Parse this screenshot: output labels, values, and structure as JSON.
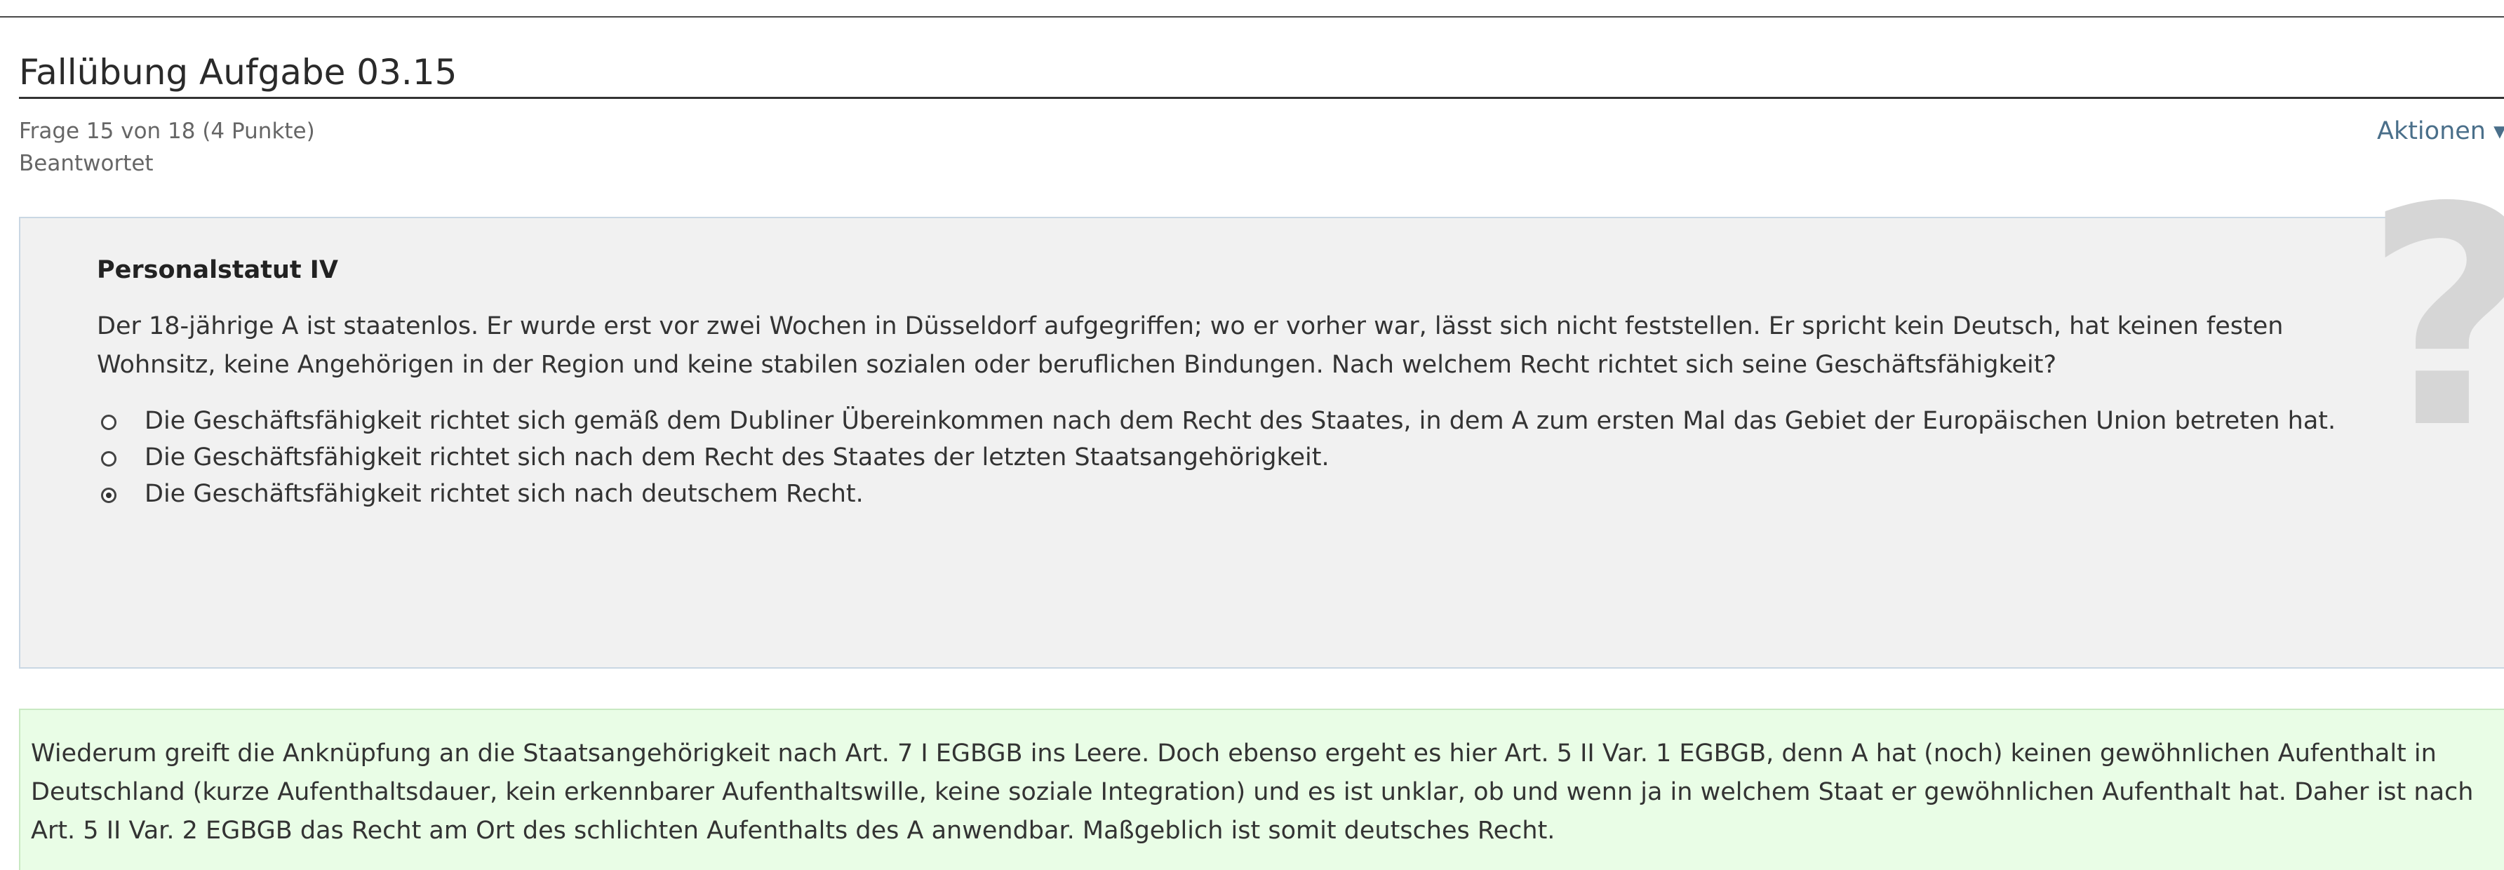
{
  "page": {
    "title": "Fallübung Aufgabe 03.15"
  },
  "question_info": {
    "number_line": "Frage 15 von 18 (4 Punkte)",
    "status": "Beantwortet"
  },
  "actions": {
    "label": "Aktionen",
    "chevron_icon": "chevron-down-icon"
  },
  "question": {
    "title": "Personalstatut IV",
    "text": "Der 18-jährige A ist staatenlos. Er wurde erst vor zwei Wochen in Düsseldorf aufgegriffen; wo er vorher war, lässt sich nicht feststellen. Er spricht kein Deutsch, hat keinen festen Wohnsitz, keine Angehörigen in der Region und keine stabilen sozialen oder beruflichen Bindungen. Nach welchem Recht richtet sich seine Geschäftsfähigkeit?",
    "watermark_icon": "question-mark-icon",
    "options": [
      {
        "label": "Die Geschäftsfähigkeit richtet sich gemäß dem Dubliner Übereinkommen nach dem Recht des Staates, in dem A zum ersten Mal das Gebiet der Europäischen Union betreten hat.",
        "selected": false
      },
      {
        "label": "Die Geschäftsfähigkeit richtet sich nach dem Recht des Staates der letzten Staatsangehörigkeit.",
        "selected": false
      },
      {
        "label": "Die Geschäftsfähigkeit richtet sich nach deutschem Recht.",
        "selected": true
      }
    ]
  },
  "feedback": {
    "text": "Wiederum greift die Anknüpfung an die Staatsangehörigkeit nach Art. 7 I EGBGB ins Leere. Doch ebenso ergeht es hier Art. 5 II Var. 1 EGBGB, denn A hat (noch) keinen gewöhnlichen Aufenthalt in Deutschland (kurze Aufenthaltsdauer, kein erkennbarer Aufenthaltswille, keine soziale Integration) und es ist unklar, ob und wenn ja in welchem Staat er gewöhnlichen Aufenthalt hat. Daher ist nach Art. 5 II Var. 2 EGBGB das Recht am Ort des schlichten Aufenthalts des A anwendbar. Maßgeblich ist somit deutsches Recht."
  },
  "colors": {
    "question_bg": "#f1f1f1",
    "question_border": "#c9d7e3",
    "feedback_bg": "#e9fde6",
    "link": "#4a6f8a"
  }
}
